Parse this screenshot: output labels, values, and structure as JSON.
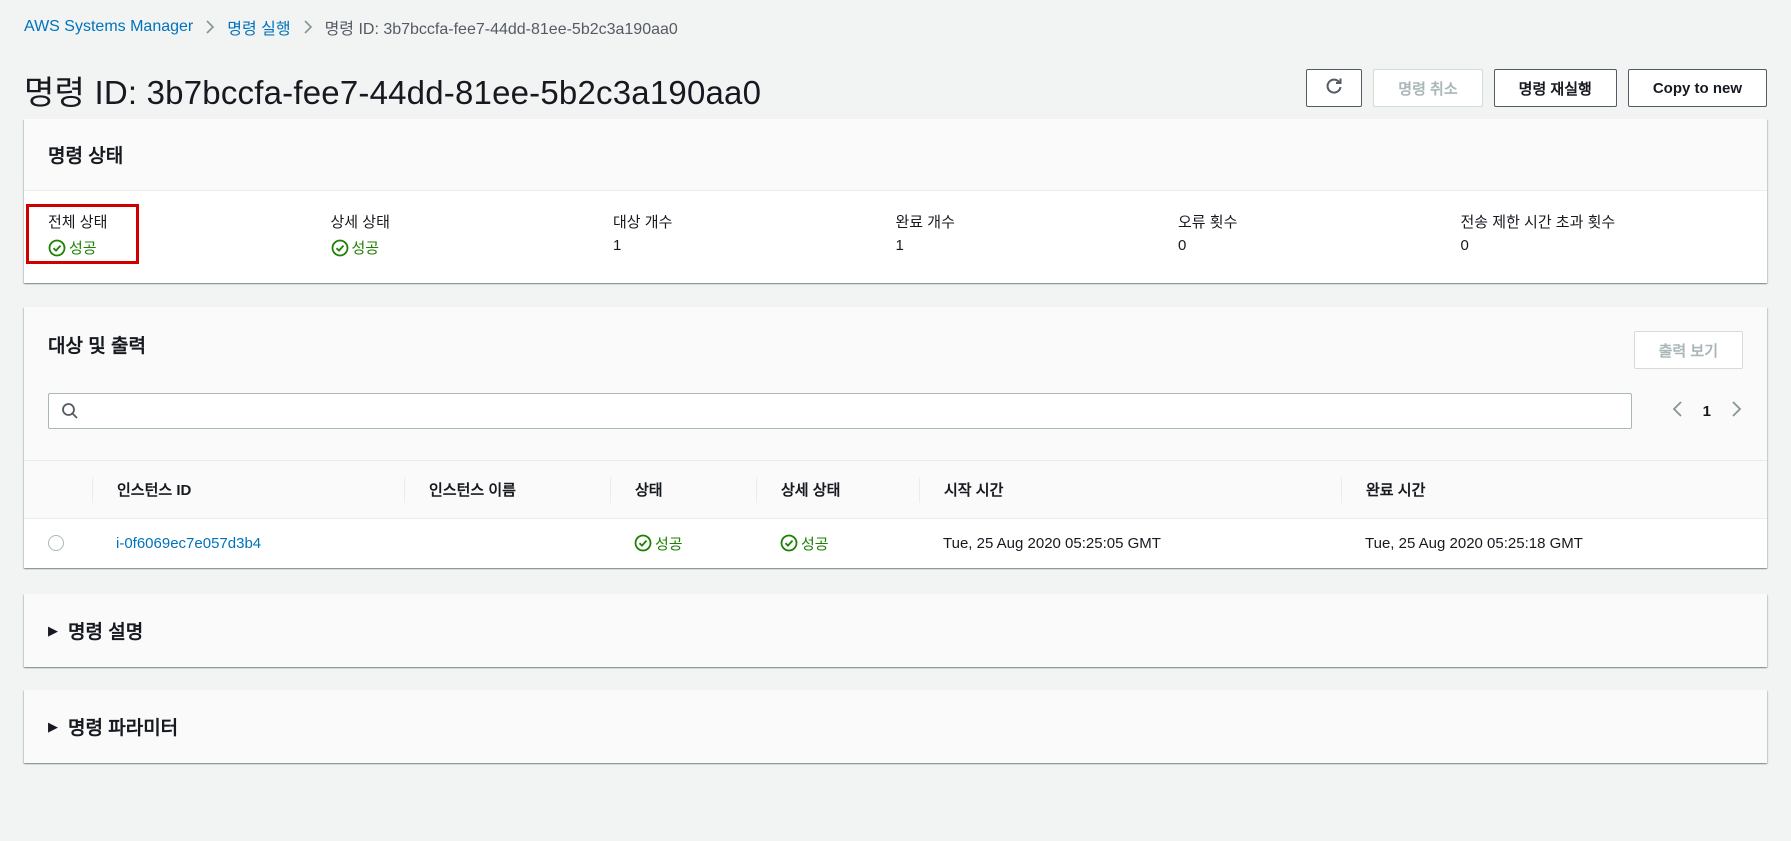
{
  "breadcrumb": {
    "items": [
      "AWS Systems Manager",
      "명령 실행"
    ],
    "current": "명령 ID: 3b7bccfa-fee7-44dd-81ee-5b2c3a190aa0"
  },
  "page": {
    "title": "명령 ID: 3b7bccfa-fee7-44dd-81ee-5b2c3a190aa0"
  },
  "actions": {
    "cancel": "명령 취소",
    "rerun": "명령 재실행",
    "copy_to_new": "Copy to new"
  },
  "status_panel": {
    "title": "명령 상태",
    "fields": [
      {
        "label": "전체 상태",
        "value": "성공",
        "type": "status"
      },
      {
        "label": "상세 상태",
        "value": "성공",
        "type": "status"
      },
      {
        "label": "대상 개수",
        "value": "1",
        "type": "text"
      },
      {
        "label": "완료 개수",
        "value": "1",
        "type": "text"
      },
      {
        "label": "오류 횟수",
        "value": "0",
        "type": "text"
      },
      {
        "label": "전송 제한 시간 초과 횟수",
        "value": "0",
        "type": "text"
      }
    ]
  },
  "targets_panel": {
    "title": "대상 및 출력",
    "view_output": "출력 보기",
    "search": {
      "value": "",
      "placeholder": ""
    },
    "pager": {
      "current_page": "1"
    },
    "columns": [
      "인스턴스 ID",
      "인스턴스 이름",
      "상태",
      "상세 상태",
      "시작 시간",
      "완료 시간"
    ],
    "rows": [
      {
        "instance_id": "i-0f6069ec7e057d3b4",
        "instance_name": "",
        "status": "성공",
        "detailed_status": "성공",
        "start_time": "Tue, 25 Aug 2020 05:25:05 GMT",
        "end_time": "Tue, 25 Aug 2020 05:25:18 GMT"
      }
    ]
  },
  "sections": {
    "description": "명령 설명",
    "parameters": "명령 파라미터"
  },
  "colors": {
    "link": "#0073bb",
    "success": "#1d8102",
    "highlight": "#d00000",
    "disabled": "#aab7b8"
  }
}
